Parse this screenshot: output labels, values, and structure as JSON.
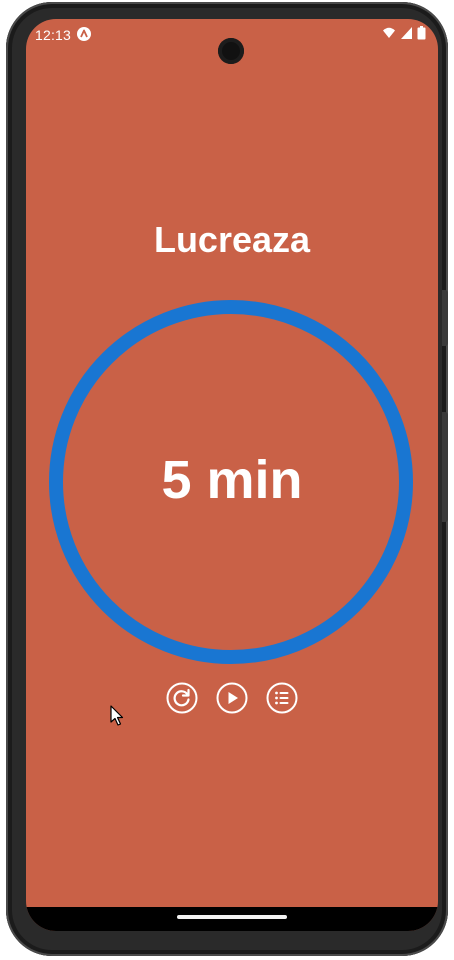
{
  "status_bar": {
    "time": "12:13",
    "app_icon": "a-notification-icon",
    "icons": [
      "wifi-icon",
      "signal-icon",
      "battery-icon"
    ]
  },
  "timer": {
    "title": "Lucreaza",
    "time_display": "5 min",
    "progress": 1.0,
    "ring_color": "#1976d2",
    "background_color": "#c96147"
  },
  "controls": {
    "reset_icon": "reset-icon",
    "play_icon": "play-icon",
    "list_icon": "list-icon"
  }
}
